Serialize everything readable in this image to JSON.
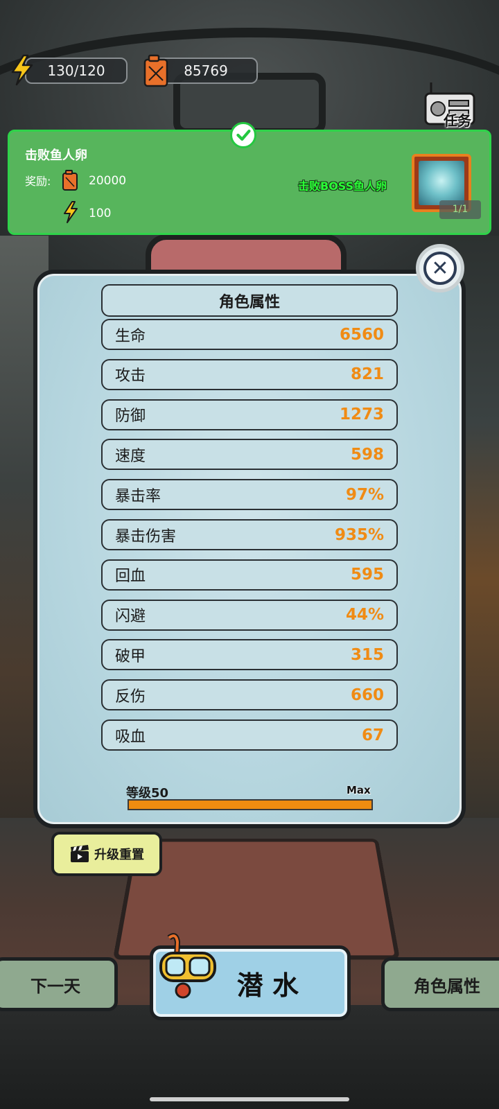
{
  "resources": {
    "energy": "130/120",
    "fuel": "85769"
  },
  "task_button": {
    "label": "任务",
    "icon": "radio-icon"
  },
  "quest": {
    "title": "击败鱼人卵",
    "reward_label": "奖励:",
    "reward_fuel": "20000",
    "reward_energy": "100",
    "target": "击败BOSS鱼人卵",
    "progress": "1/1",
    "status": "completed"
  },
  "panel": {
    "title": "角色属性",
    "close_icon": "close-icon",
    "stats": [
      {
        "name": "生命",
        "value": "6560"
      },
      {
        "name": "攻击",
        "value": "821"
      },
      {
        "name": "防御",
        "value": "1273"
      },
      {
        "name": "速度",
        "value": "598"
      },
      {
        "name": "暴击率",
        "value": "97%"
      },
      {
        "name": "暴击伤害",
        "value": "935%"
      },
      {
        "name": "回血",
        "value": "595"
      },
      {
        "name": "闪避",
        "value": "44%"
      },
      {
        "name": "破甲",
        "value": "315"
      },
      {
        "name": "反伤",
        "value": "660"
      },
      {
        "name": "吸血",
        "value": "67"
      }
    ],
    "level_label": "等级50",
    "level_max": "Max",
    "level_progress": 1.0
  },
  "reset_button": {
    "label": "升级重置",
    "icon": "video-clapper-icon"
  },
  "bottom_nav": {
    "next_day": "下一天",
    "dive": "潜 水",
    "attributes": "角色属性"
  },
  "colors": {
    "quest_bg": "#57b55c",
    "quest_border": "#2fd34a",
    "stat_value": "#f08b14",
    "panel_bg": "#b6d6df",
    "level_fill": "#ef8c10",
    "reset_bg": "#e9ee9c",
    "dive_bg": "#9fd0e6",
    "nav_bg": "#8fa98f"
  }
}
